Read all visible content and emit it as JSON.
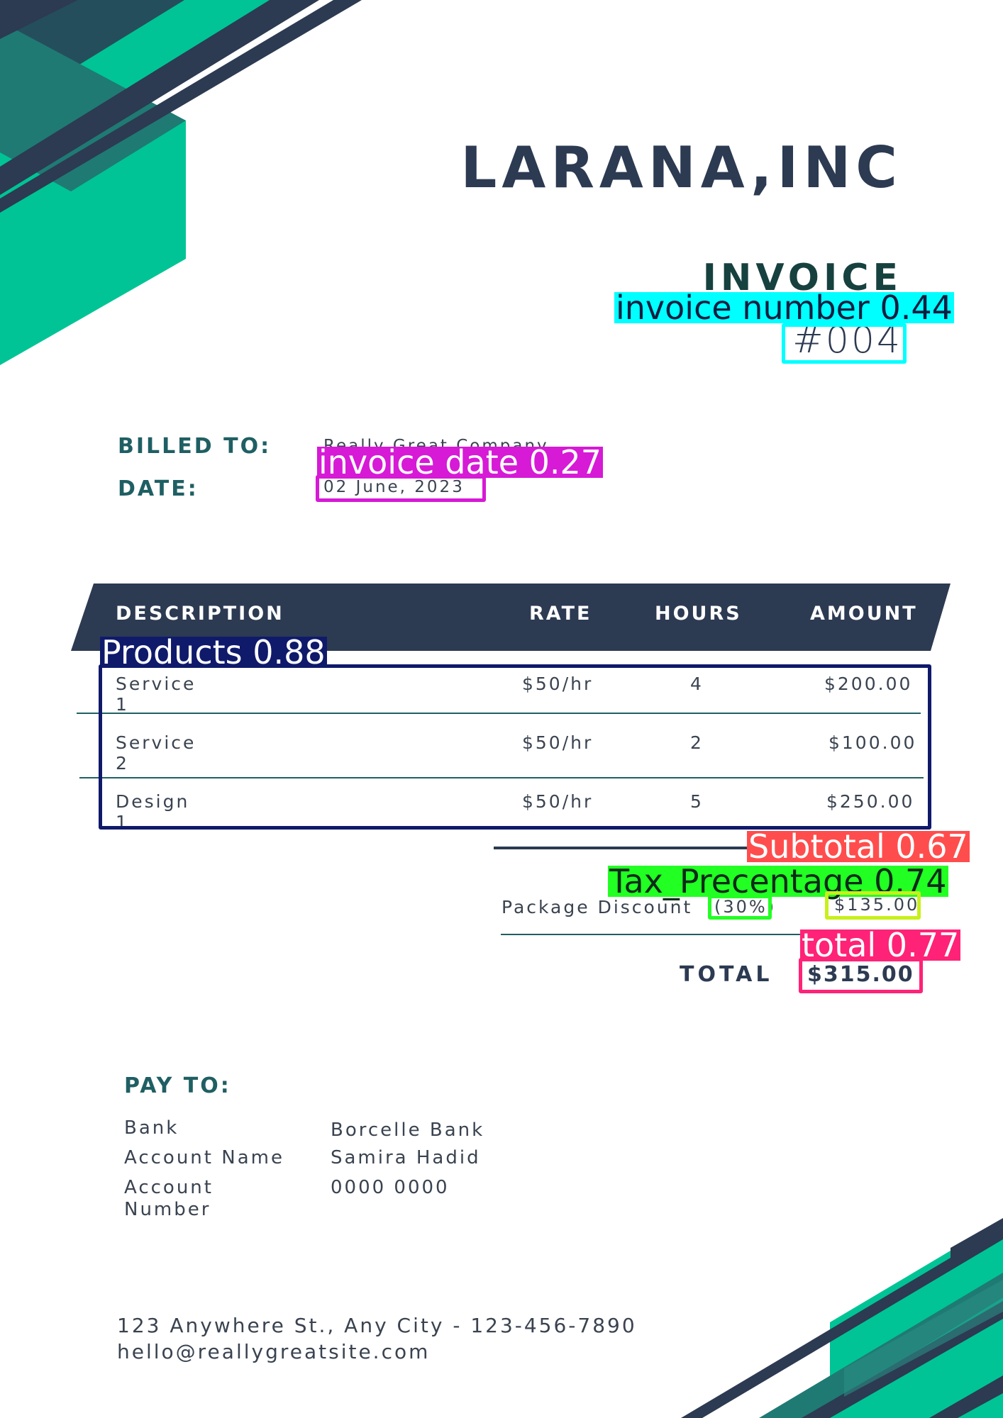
{
  "colors": {
    "navy": "#2c3a52",
    "teal": "#00c495",
    "dark_teal": "#1f7a74",
    "heading_teal": "#1f5f63"
  },
  "header": {
    "company": "LARANA,INC",
    "title": "INVOICE",
    "number": "#004"
  },
  "billing": {
    "billed_to_label": "BILLED TO:",
    "billed_to_value": "Really Great Company",
    "date_label": "DATE:",
    "date_value": "02 June, 2023"
  },
  "table": {
    "headers": [
      "DESCRIPTION",
      "RATE",
      "HOURS",
      "AMOUNT"
    ],
    "rows": [
      [
        "Service 1",
        "$50/hr",
        "4",
        "$200.00"
      ],
      [
        "Service 2",
        "$50/hr",
        "2",
        "$100.00"
      ],
      [
        "Design 1",
        "$50/hr",
        "5",
        "$250.00"
      ]
    ]
  },
  "summary": {
    "discount_label": "Package Discount",
    "discount_pct": "(30%)",
    "discount_value": "$135.00",
    "total_label": "TOTAL",
    "total_value": "$315.00"
  },
  "pay_to": {
    "heading": "PAY TO:",
    "bank_label": "Bank",
    "bank_value": "Borcelle Bank",
    "account_name_label": "Account Name",
    "account_name_value": "Samira Hadid",
    "account_number_label_1": "Account",
    "account_number_label_2": "Number",
    "account_number_value": "0000 0000"
  },
  "footer": {
    "address": "123 Anywhere St., Any City - 123-456-7890",
    "email": "hello@reallygreatsite.com"
  },
  "overlays": {
    "invoice_number": "invoice number 0.44",
    "invoice_date": "invoice date 0.27",
    "products": "Products 0.88",
    "subtotal": "Subtotal 0.67",
    "tax": "Tax_Precentage 0.74",
    "total": "total 0.77",
    "colors": {
      "invoice_number": "#00ffff",
      "invoice_date": "#d61ad6",
      "products": "#0f1a6b",
      "subtotal": "#ff4d4d",
      "tax": "#22ff22",
      "tax_value": "#c8f01a",
      "total": "#ff2277"
    }
  }
}
